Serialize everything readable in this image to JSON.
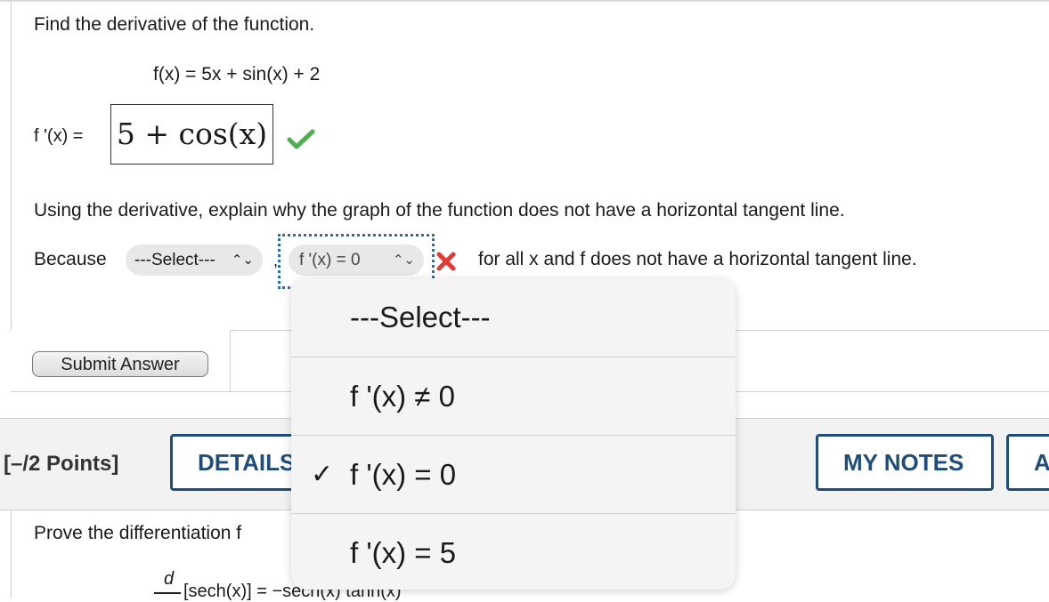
{
  "question1": {
    "instruction": "Find the derivative of the function.",
    "function_text": "f(x) = 5x + sin(x) + 2",
    "derivative_label": "f '(x) =",
    "derivative_answer": "5 + cos(x)",
    "explain_prompt": "Using the derivative, explain why the graph of the function does not have a horizontal tangent line.",
    "because_label": "Because",
    "select1_value": "---Select---",
    "select2_value": "f '(x) = 0",
    "after_text": "for all x and f does not have a horizontal tangent line.",
    "submit_label": "Submit Answer"
  },
  "question2_header": {
    "points": "[–/2 Points]",
    "details_label": "DETAILS",
    "my_notes_label": "MY NOTES",
    "partial_label": "A"
  },
  "question2": {
    "instruction_partial": "Prove the differentiation f",
    "formula_partial": "[sech(x)] = −sech(x) tanh(x)",
    "formula_d": "d"
  },
  "dropdown": {
    "options": [
      {
        "label": "---Select---",
        "selected": false
      },
      {
        "label": "f '(x) ≠ 0",
        "selected": false
      },
      {
        "label": "f '(x) = 0",
        "selected": true
      },
      {
        "label": "f '(x) = 5",
        "selected": false
      }
    ],
    "check_glyph": "✓"
  },
  "colors": {
    "accent": "#1f4d7a",
    "focus": "#2b6cb0",
    "correct": "#4caf50",
    "incorrect": "#e53935"
  }
}
